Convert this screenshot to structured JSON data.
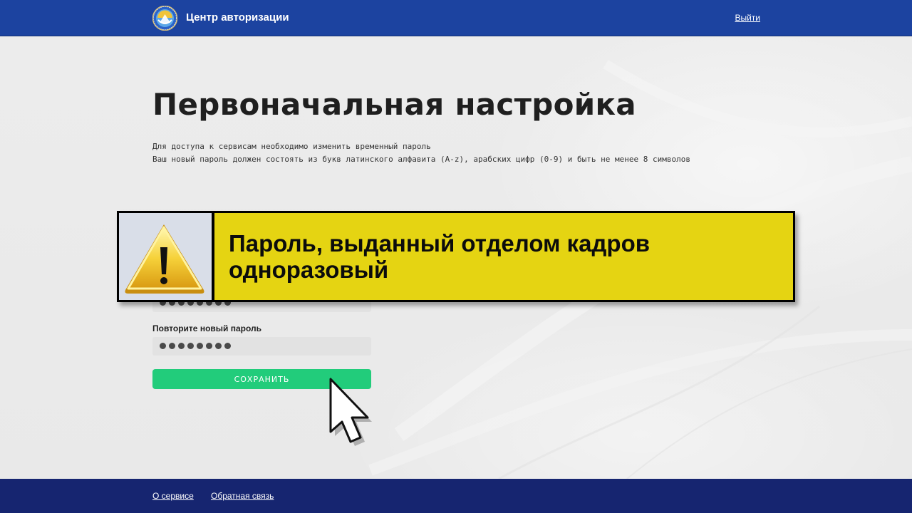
{
  "header": {
    "title": "Центр авторизации",
    "logout_label": "Выйти",
    "logo_icon": "kyrgyz-emblem-icon"
  },
  "main": {
    "title": "Первоначальная настройка",
    "description": [
      "Для доступа к сервисам необходимо изменить временный пароль",
      "Ваш новый пароль должен состоять из букв латинского алфавита (A-z), арабских цифр (0-9) и быть не менее 8 символов"
    ],
    "new_password": {
      "masked_length": 8
    },
    "repeat_password": {
      "label": "Повторите новый пароль",
      "masked_length": 8
    },
    "save_label": "СОХРАНИТЬ",
    "accent_color": "#22cc7b"
  },
  "overlay": {
    "line1": "Пароль, выданный отделом кадров",
    "line2": "одноразовый",
    "icon": "warning-icon",
    "background_color": "#e5d412"
  },
  "footer": {
    "links": [
      "О сервисе",
      "Обратная связь"
    ]
  }
}
